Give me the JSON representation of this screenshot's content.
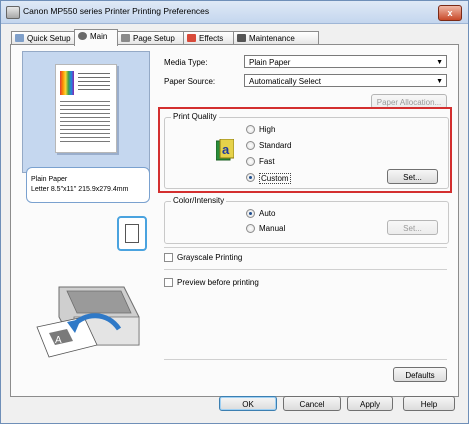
{
  "window": {
    "title": "Canon MP550 series Printer Printing Preferences",
    "close_symbol": "x"
  },
  "tabs": [
    {
      "label": "Quick Setup",
      "icon": "quick-setup-icon"
    },
    {
      "label": "Main",
      "icon": "main-icon",
      "active": true
    },
    {
      "label": "Page Setup",
      "icon": "page-setup-icon"
    },
    {
      "label": "Effects",
      "icon": "effects-icon"
    },
    {
      "label": "Maintenance",
      "icon": "maintenance-icon"
    }
  ],
  "preview": {
    "paper_info_line1": "Plain Paper",
    "paper_info_line2": "Letter 8.5\"x11\" 215.9x279.4mm"
  },
  "main": {
    "media_type_label": "Media Type:",
    "media_type_value": "Plain Paper",
    "paper_source_label": "Paper Source:",
    "paper_source_value": "Automatically Select",
    "paper_allocation_button": "Paper Allocation...",
    "print_quality": {
      "title": "Print Quality",
      "options": [
        "High",
        "Standard",
        "Fast",
        "Custom"
      ],
      "selected": "Custom",
      "set_button": "Set..."
    },
    "color_intensity": {
      "title": "Color/Intensity",
      "options": [
        "Auto",
        "Manual"
      ],
      "selected": "Auto",
      "set_button": "Set..."
    },
    "grayscale_label": "Grayscale Printing",
    "grayscale_checked": false,
    "preview_label": "Preview before printing",
    "preview_checked": false,
    "defaults_button": "Defaults"
  },
  "footer": {
    "ok": "OK",
    "cancel": "Cancel",
    "apply": "Apply",
    "help": "Help"
  },
  "colors": {
    "highlight_border": "#d32f2f",
    "titlebar": "#c4d6ee",
    "close_button": "#c8492a"
  }
}
